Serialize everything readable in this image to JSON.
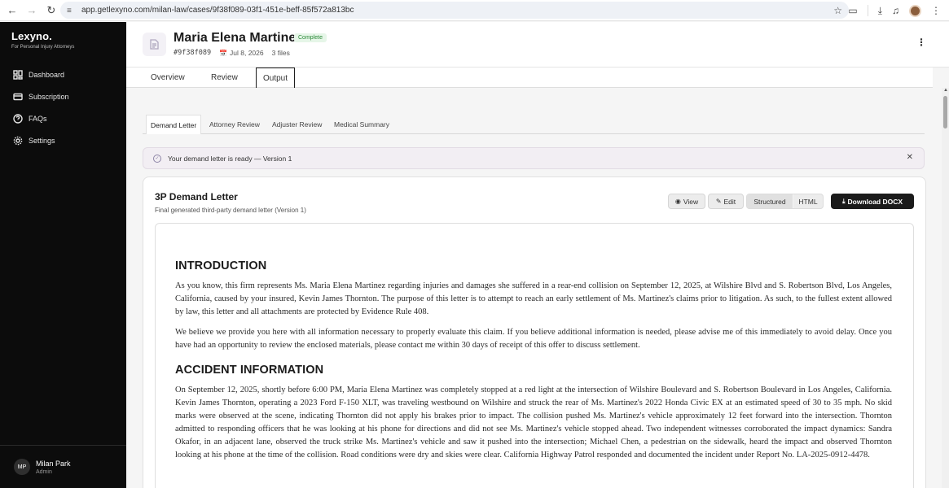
{
  "browser": {
    "url": "app.getlexyno.com/milan-law/cases/9f38f089-03f1-451e-beff-85f572a813bc"
  },
  "sidebar": {
    "brand_name": "Lexyno.",
    "brand_tagline": "For Personal Injury Attorneys",
    "items": [
      {
        "label": "Dashboard",
        "icon": "dashboard-icon"
      },
      {
        "label": "Subscription",
        "icon": "card-icon"
      },
      {
        "label": "FAQs",
        "icon": "help-icon"
      },
      {
        "label": "Settings",
        "icon": "gear-icon"
      }
    ],
    "user": {
      "initials": "MP",
      "name": "Milan Park",
      "role": "Admin"
    }
  },
  "header": {
    "title": "Maria Elena Martinez",
    "status": "Complete",
    "case_id": "#9f38f089",
    "date": "Jul 8, 2026",
    "files": "3 files"
  },
  "top_tabs": [
    "Overview",
    "Review",
    "Output"
  ],
  "sub_tabs": [
    "Demand Letter",
    "Attorney Review",
    "Adjuster Review",
    "Medical Summary"
  ],
  "alert": {
    "message": "Your demand letter is ready — Version 1"
  },
  "card": {
    "title": "3P Demand Letter",
    "subtitle": "Final generated third-party demand letter (Version 1)",
    "view_label": "View",
    "edit_label": "Edit",
    "structured_label": "Structured",
    "html_label": "HTML",
    "download_label": "Download DOCX"
  },
  "letter": {
    "intro_heading": "INTRODUCTION",
    "intro_p1": "As you know, this firm represents Ms. Maria Elena Martinez regarding injuries and damages she suffered in a rear-end collision on September 12, 2025, at Wilshire Blvd and S. Robertson Blvd, Los Angeles, California, caused by your insured, Kevin James Thornton. The purpose of this letter is to attempt to reach an early settlement of Ms. Martinez's claims prior to litigation. As such, to the fullest extent allowed by law, this letter and all attachments are protected by Evidence Rule 408.",
    "intro_p2": "We believe we provide you here with all information necessary to properly evaluate this claim. If you believe additional information is needed, please advise me of this immediately to avoid delay. Once you have had an opportunity to review the enclosed materials, please contact me within 30 days of receipt of this offer to discuss settlement.",
    "accident_heading": "ACCIDENT INFORMATION",
    "accident_p1": "On September 12, 2025, shortly before 6:00 PM, Maria Elena Martinez was completely stopped at a red light at the intersection of Wilshire Boulevard and S. Robertson Boulevard in Los Angeles, California. Kevin James Thornton, operating a 2023 Ford F-150 XLT, was traveling westbound on Wilshire and struck the rear of Ms. Martinez's 2022 Honda Civic EX at an estimated speed of 30 to 35 mph. No skid marks were observed at the scene, indicating Thornton did not apply his brakes prior to impact. The collision pushed Ms. Martinez's vehicle approximately 12 feet forward into the intersection. Thornton admitted to responding officers that he was looking at his phone for directions and did not see Ms. Martinez's vehicle stopped ahead. Two independent witnesses corroborated the impact dynamics: Sandra Okafor, in an adjacent lane, observed the truck strike Ms. Martinez's vehicle and saw it pushed into the intersection; Michael Chen, a pedestrian on the sidewalk, heard the impact and observed Thornton looking at his phone at the time of the collision. Road conditions were dry and skies were clear. California Highway Patrol responded and documented the incident under Report No. LA-2025-0912-4478."
  }
}
